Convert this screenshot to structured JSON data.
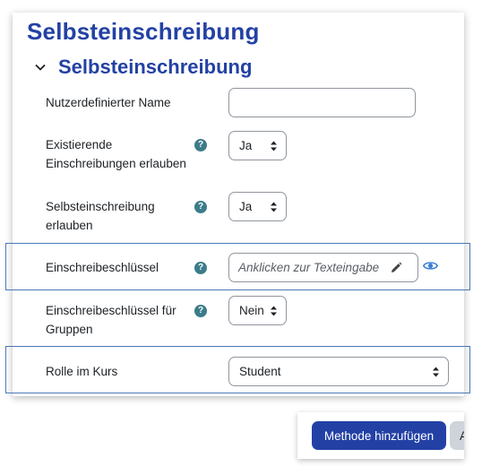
{
  "page": {
    "title": "Selbsteinschreibung"
  },
  "section": {
    "title": "Selbsteinschreibung",
    "toggle_icon": "chevron-down-icon"
  },
  "fields": {
    "custom_name": {
      "label": "Nutzerdefinierter Name",
      "value": ""
    },
    "existing_enrolments": {
      "label_line1": "Existierende",
      "label_line2": "Einschreibungen erlauben",
      "help_icon": "?",
      "value": "Ja"
    },
    "self_enrolment": {
      "label_line1": "Selbsteinschreibung",
      "label_line2": "erlauben",
      "help_icon": "?",
      "value": "Ja"
    },
    "enrolment_key": {
      "label": "Einschreibeschlüssel",
      "help_icon": "?",
      "placeholder": "Anklicken zur Texteingabe",
      "edit_icon": "pencil-icon",
      "reveal_icon": "eye-icon"
    },
    "group_key": {
      "label_line1": "Einschreibeschlüssel für",
      "label_line2": "Gruppen",
      "help_icon": "?",
      "value": "Nein"
    },
    "role": {
      "label": "Rolle im Kurs",
      "value": "Student"
    }
  },
  "footer": {
    "submit_label": "Methode hinzufügen",
    "cancel_label_visible": "A"
  },
  "colors": {
    "brand": "#2341a5",
    "help_badge": "#3c7c8a",
    "highlight_border": "#4c78b7",
    "secondary_button": "#ced4da"
  }
}
